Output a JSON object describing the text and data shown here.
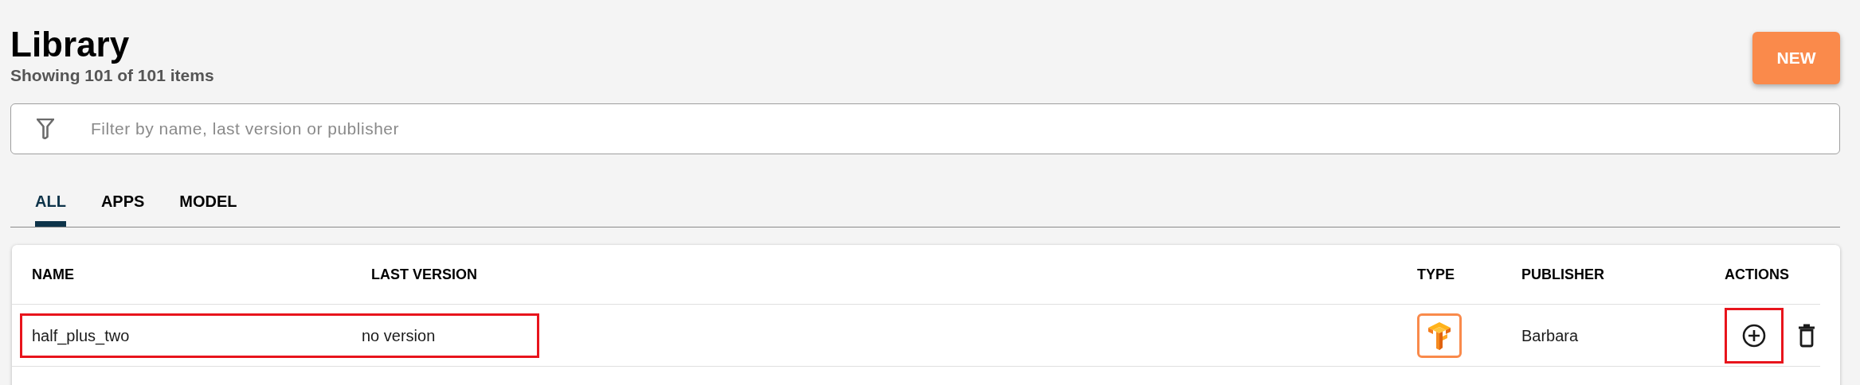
{
  "header": {
    "title": "Library",
    "subtitle": "Showing 101 of 101 items",
    "new_button": "NEW"
  },
  "filter": {
    "placeholder": "Filter by name, last version or publisher"
  },
  "tabs": [
    {
      "label": "ALL",
      "selected": true
    },
    {
      "label": "APPS",
      "selected": false
    },
    {
      "label": "MODEL",
      "selected": false
    }
  ],
  "table": {
    "columns": [
      "NAME",
      "LAST VERSION",
      "TYPE",
      "PUBLISHER",
      "ACTIONS"
    ],
    "rows": [
      {
        "name": "half_plus_two",
        "last_version": "no version",
        "publisher": "Barbara",
        "highlighted": true,
        "add_highlighted": true
      }
    ]
  }
}
